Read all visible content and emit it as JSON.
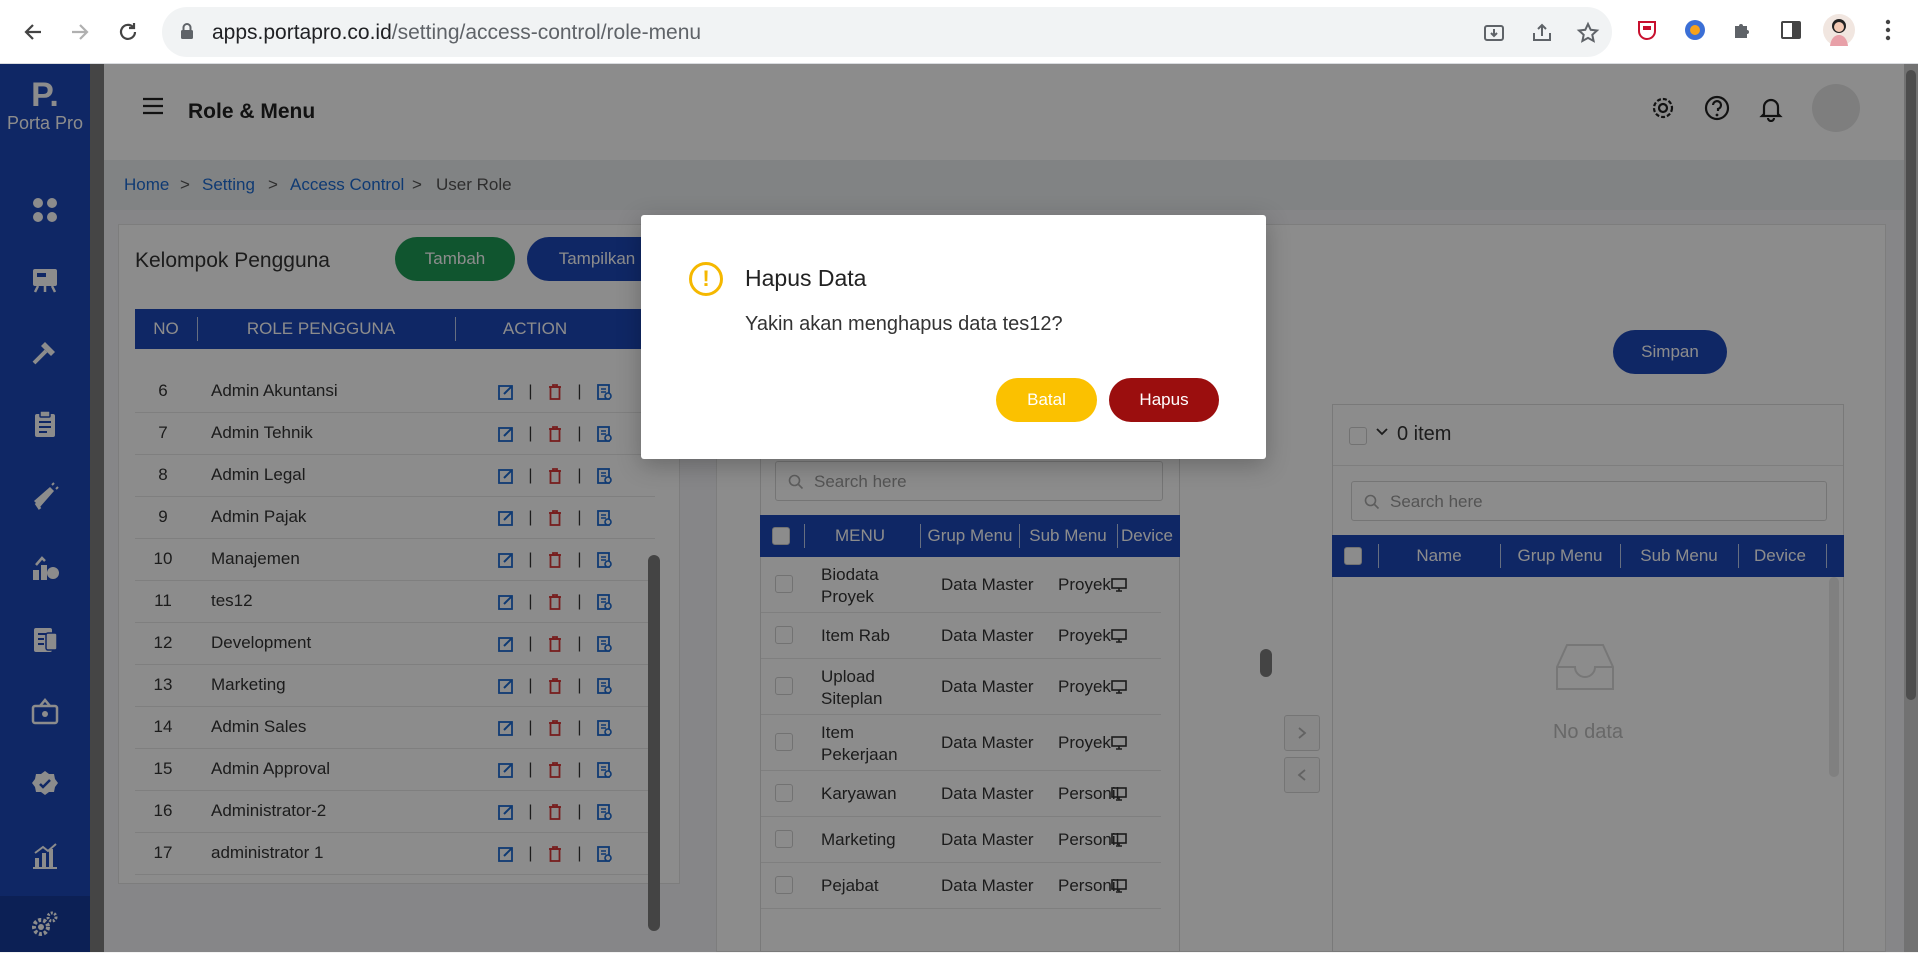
{
  "browser": {
    "url_host": "apps.portapro.co.id",
    "url_path": "/setting/access-control/role-menu"
  },
  "sidebar": {
    "logo_mark": "P.",
    "logo_name": "Porta Pro",
    "icons": [
      "dashboard-icon",
      "project-board-icon",
      "tools-icon",
      "clipboard-icon",
      "megaphone-icon",
      "money-growth-icon",
      "invoice-icon",
      "ticket-icon",
      "verified-badge-icon",
      "bar-chart-icon",
      "settings-icon"
    ]
  },
  "topbar": {
    "title": "Role & Menu",
    "icons": [
      "settings-icon",
      "help-icon",
      "bell-icon"
    ]
  },
  "breadcrumb": {
    "home": "Home",
    "setting": "Setting",
    "access_control": "Access Control",
    "current": "User Role",
    "sep": ">"
  },
  "left_card": {
    "title": "Kelompok Pengguna",
    "tambah": "Tambah",
    "tampilkan": "Tampilkan",
    "columns": [
      "NO",
      "ROLE PENGGUNA",
      "ACTION"
    ],
    "action_sep": "|",
    "rows": [
      {
        "no": "6",
        "name": "Admin Akuntansi"
      },
      {
        "no": "7",
        "name": "Admin Tehnik"
      },
      {
        "no": "8",
        "name": "Admin Legal"
      },
      {
        "no": "9",
        "name": "Admin Pajak"
      },
      {
        "no": "10",
        "name": "Manajemen"
      },
      {
        "no": "11",
        "name": "tes12"
      },
      {
        "no": "12",
        "name": "Development"
      },
      {
        "no": "13",
        "name": "Marketing"
      },
      {
        "no": "14",
        "name": "Admin Sales"
      },
      {
        "no": "15",
        "name": "Admin Approval"
      },
      {
        "no": "16",
        "name": "Administrator-2"
      },
      {
        "no": "17",
        "name": "administrator 1"
      }
    ]
  },
  "right_card": {
    "simpan": "Simpan",
    "source": {
      "search_placeholder": "Search here",
      "columns": [
        "MENU",
        "Grup Menu",
        "Sub Menu",
        "Device"
      ],
      "rows": [
        {
          "menu": "Biodata Proyek",
          "menu_l1": "Biodata",
          "menu_l2": "Proyek",
          "grup": "Data Master",
          "sub": "Proyek"
        },
        {
          "menu": "Item Rab",
          "grup": "Data Master",
          "sub": "Proyek"
        },
        {
          "menu": "Upload Siteplan",
          "menu_l1": "Upload",
          "menu_l2": "Siteplan",
          "grup": "Data Master",
          "sub": "Proyek"
        },
        {
          "menu": "Item Pekerjaan",
          "menu_l1": "Item",
          "menu_l2": "Pekerjaan",
          "grup": "Data Master",
          "sub": "Proyek"
        },
        {
          "menu": "Karyawan",
          "grup": "Data Master",
          "sub": "Personil"
        },
        {
          "menu": "Marketing",
          "grup": "Data Master",
          "sub": "Personil"
        },
        {
          "menu": "Pejabat",
          "grup": "Data Master",
          "sub": "Personil"
        }
      ]
    },
    "target": {
      "count_label": "0 item",
      "search_placeholder": "Search here",
      "columns": [
        "Name",
        "Grup Menu",
        "Sub Menu",
        "Device"
      ],
      "empty_text": "No data"
    }
  },
  "modal": {
    "title": "Hapus Data",
    "message": "Yakin akan menghapus data tes12?",
    "cancel": "Batal",
    "confirm": "Hapus",
    "warn_glyph": "!"
  },
  "colors": {
    "primary": "#1c47b9",
    "success": "#1e9c57",
    "warning": "#fbc100",
    "danger": "#9b0e0e"
  }
}
